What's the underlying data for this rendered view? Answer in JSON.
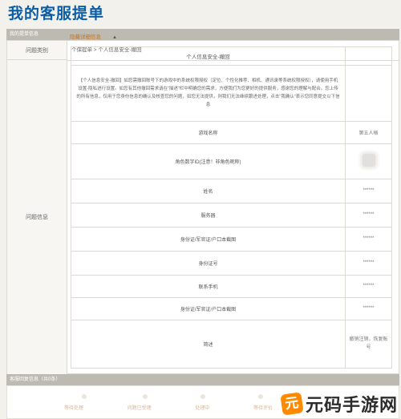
{
  "page_title": "我的客服提单",
  "section1_header": "我的提单信息",
  "section2_header": "客服回复信息（共0条）",
  "category": {
    "label": "问题类别",
    "value": "个保提单 > 个人信息安全-撤回"
  },
  "info": {
    "label": "问题信息",
    "toggle": "隐藏详细信息",
    "toggle_icon": "caret-up-icon",
    "table_title": "个人信息安全-撤回",
    "description": "【个人信息安全-撤回】如您需撤回账号下的游戏中的系统权限授权（定位、个性化推荐、相机、通讯录等系统权限授权），请使用手机设置-隐私进行设置。如您有其他撤回需求请在“描述”栏中明确您的需求，方便我们为您更好的提供服务，感谢您的理解与配合。您上传的所有信息，仅用于您身份信息的确认及核查您的问题，如您无法提供，则我们无法继续跟进处理，点击“我确认”表示您同意提交以下信息",
    "rows": [
      {
        "label": "游戏名称",
        "value": "第五人格"
      },
      {
        "label": "角色数字ID(注意！非角色昵称)",
        "value": ""
      },
      {
        "label": "姓名",
        "value": "******"
      },
      {
        "label": "服务器",
        "value": "******"
      },
      {
        "label": "身份证/军官证/户口本截图",
        "value": "******"
      },
      {
        "label": "身份证号",
        "value": "******"
      },
      {
        "label": "联系手机",
        "value": "******"
      },
      {
        "label": "身份证/军官证/户口本截图",
        "value": "******"
      },
      {
        "label": "简述",
        "value": "撤销注销，恢复账号"
      }
    ]
  },
  "steps": [
    "等待处理",
    "问题已受理",
    "处理中",
    "等待评价"
  ],
  "watermark": {
    "logo_char": "元",
    "text": "元码手游网"
  }
}
